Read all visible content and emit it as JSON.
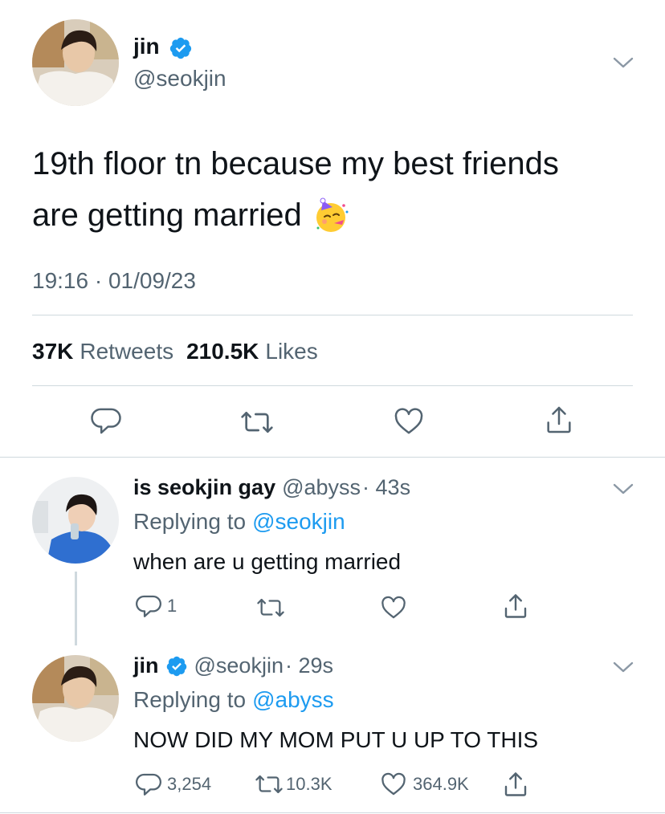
{
  "main_tweet": {
    "name": "jin",
    "handle": "@seokjin",
    "text_line1": "19th floor tn because my best friends",
    "text_line2": "are getting married",
    "emoji": "partying-face",
    "timestamp": "19:16 · 01/09/23",
    "retweets_count": "37K",
    "retweets_label": "Retweets",
    "likes_count": "210.5K",
    "likes_label": "Likes"
  },
  "reply1": {
    "name": "is seokjin gay",
    "handle": "@abyss",
    "time": "· 43s",
    "replying_prefix": "Replying to",
    "replying_to": "@seokjin",
    "text": "when are u getting married",
    "reply_count": "1"
  },
  "reply2": {
    "name": "jin",
    "handle": "@seokjin",
    "time": "· 29s",
    "replying_prefix": "Replying to",
    "replying_to": "@abyss",
    "text": "NOW DID MY MOM PUT U UP TO THIS",
    "reply_count": "3,254",
    "retweet_count": "10.3K",
    "like_count": "364.9K"
  },
  "colors": {
    "accent": "#1d9bf0",
    "secondary_text": "#536471",
    "divider": "#cfd9de"
  }
}
